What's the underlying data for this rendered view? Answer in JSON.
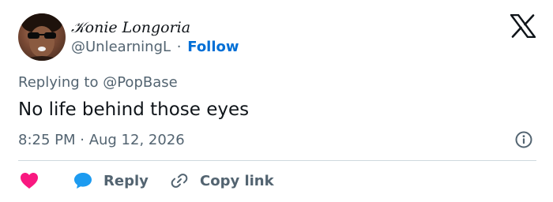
{
  "author": {
    "display_name": "𝒦𝑜𝑛𝑖𝑒 𝐿𝑜𝑛𝑔𝑜𝑟𝑖𝑎",
    "handle": "@UnlearningL",
    "separator": "·",
    "follow_label": "Follow"
  },
  "brand": {
    "logo": "x-logo-icon"
  },
  "tweet": {
    "replying_prefix": "Replying to",
    "replying_to": "@PopBase",
    "text": "No life behind those eyes",
    "timestamp": "8:25 PM · Aug 12, 2026"
  },
  "actions": {
    "like_icon": "heart-icon",
    "reply_label": "Reply",
    "reply_icon": "speech-bubble-icon",
    "copy_label": "Copy link",
    "copy_icon": "link-icon"
  },
  "colors": {
    "text": "#0f1419",
    "muted": "#536471",
    "follow": "#006fd6",
    "like": "#f91880",
    "reply": "#1d9bf0",
    "divider": "#cfd9de"
  }
}
